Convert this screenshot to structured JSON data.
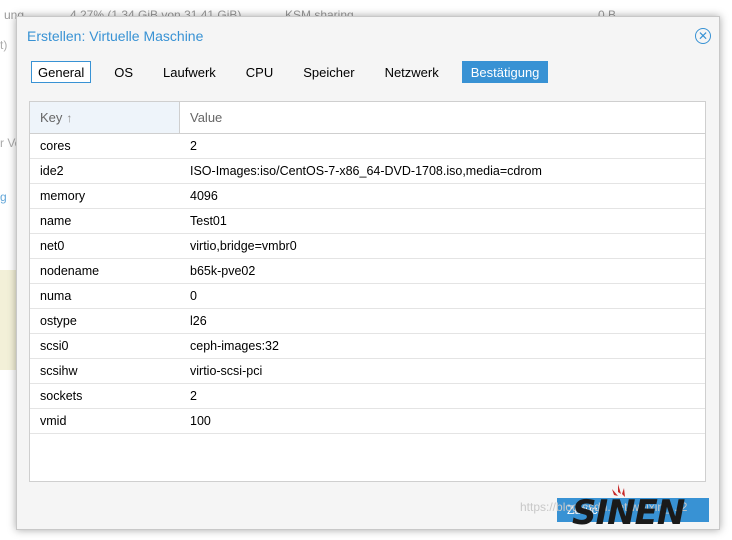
{
  "background": {
    "row_left": "ung",
    "row_middle": "4,27% (1,34 GiB von 31,41 GiB)",
    "row_ksm": "KSM sharing",
    "row_right": "0 B",
    "side_text_1": "t)",
    "side_text_2": "r Ve",
    "side_text_3": "g"
  },
  "dialog": {
    "title": "Erstellen: Virtuelle Maschine",
    "tabs": [
      {
        "label": "General"
      },
      {
        "label": "OS"
      },
      {
        "label": "Laufwerk"
      },
      {
        "label": "CPU"
      },
      {
        "label": "Speicher"
      },
      {
        "label": "Netzwerk"
      },
      {
        "label": "Bestätigung"
      }
    ],
    "grid": {
      "columns": {
        "key": "Key",
        "value": "Value"
      },
      "rows": [
        {
          "key": "cores",
          "value": "2"
        },
        {
          "key": "ide2",
          "value": "ISO-Images:iso/CentOS-7-x86_64-DVD-1708.iso,media=cdrom"
        },
        {
          "key": "memory",
          "value": "4096"
        },
        {
          "key": "name",
          "value": "Test01"
        },
        {
          "key": "net0",
          "value": "virtio,bridge=vmbr0"
        },
        {
          "key": "nodename",
          "value": "b65k-pve02"
        },
        {
          "key": "numa",
          "value": "0"
        },
        {
          "key": "ostype",
          "value": "l26"
        },
        {
          "key": "scsi0",
          "value": "ceph-images:32"
        },
        {
          "key": "scsihw",
          "value": "virtio-scsi-pci"
        },
        {
          "key": "sockets",
          "value": "2"
        },
        {
          "key": "vmid",
          "value": "100"
        }
      ]
    },
    "back_button": "Zurück",
    "watermark": "https://blog.csdn.net/weixin_...2"
  },
  "colors": {
    "accent": "#3892d4"
  }
}
